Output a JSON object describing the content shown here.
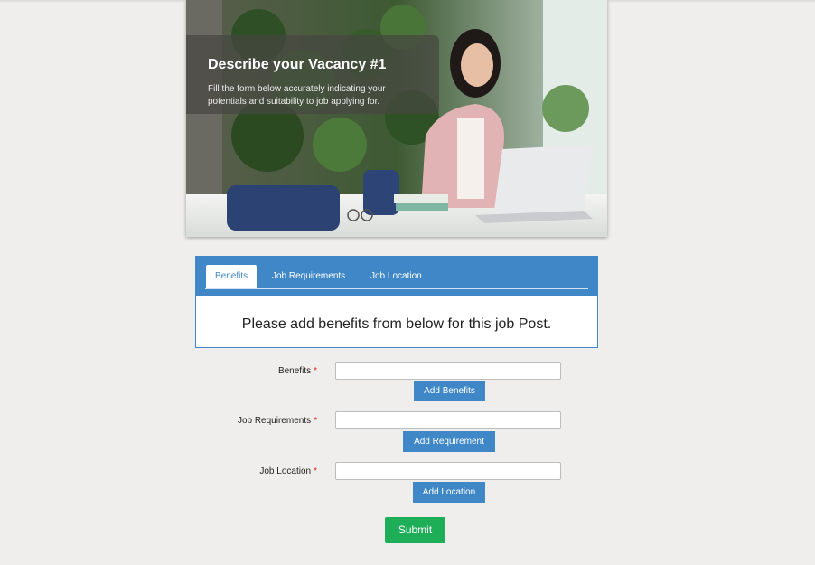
{
  "hero": {
    "title": "Describe your Vacancy #1",
    "subtitle": "Fill the form below accurately indicating your potentials and suitability to job applying for."
  },
  "tabs": [
    {
      "label": "Benefits",
      "active": true
    },
    {
      "label": "Job Requirements",
      "active": false
    },
    {
      "label": "Job Location",
      "active": false
    }
  ],
  "tab_content": "Please add benefits from below for this job Post.",
  "form": {
    "benefits": {
      "label": "Benefits",
      "required_mark": "*",
      "value": "",
      "button": "Add Benefits"
    },
    "requirements": {
      "label": "Job Requirements",
      "required_mark": "*",
      "value": "",
      "button": "Add Requirement"
    },
    "location": {
      "label": "Job Location",
      "required_mark": "*",
      "value": "",
      "button": "Add Location"
    }
  },
  "submit_label": "Submit",
  "colors": {
    "page_bg": "#efeeec",
    "accent_blue": "#3f87c7",
    "submit_green": "#1fae58",
    "required_red": "#e02424"
  }
}
